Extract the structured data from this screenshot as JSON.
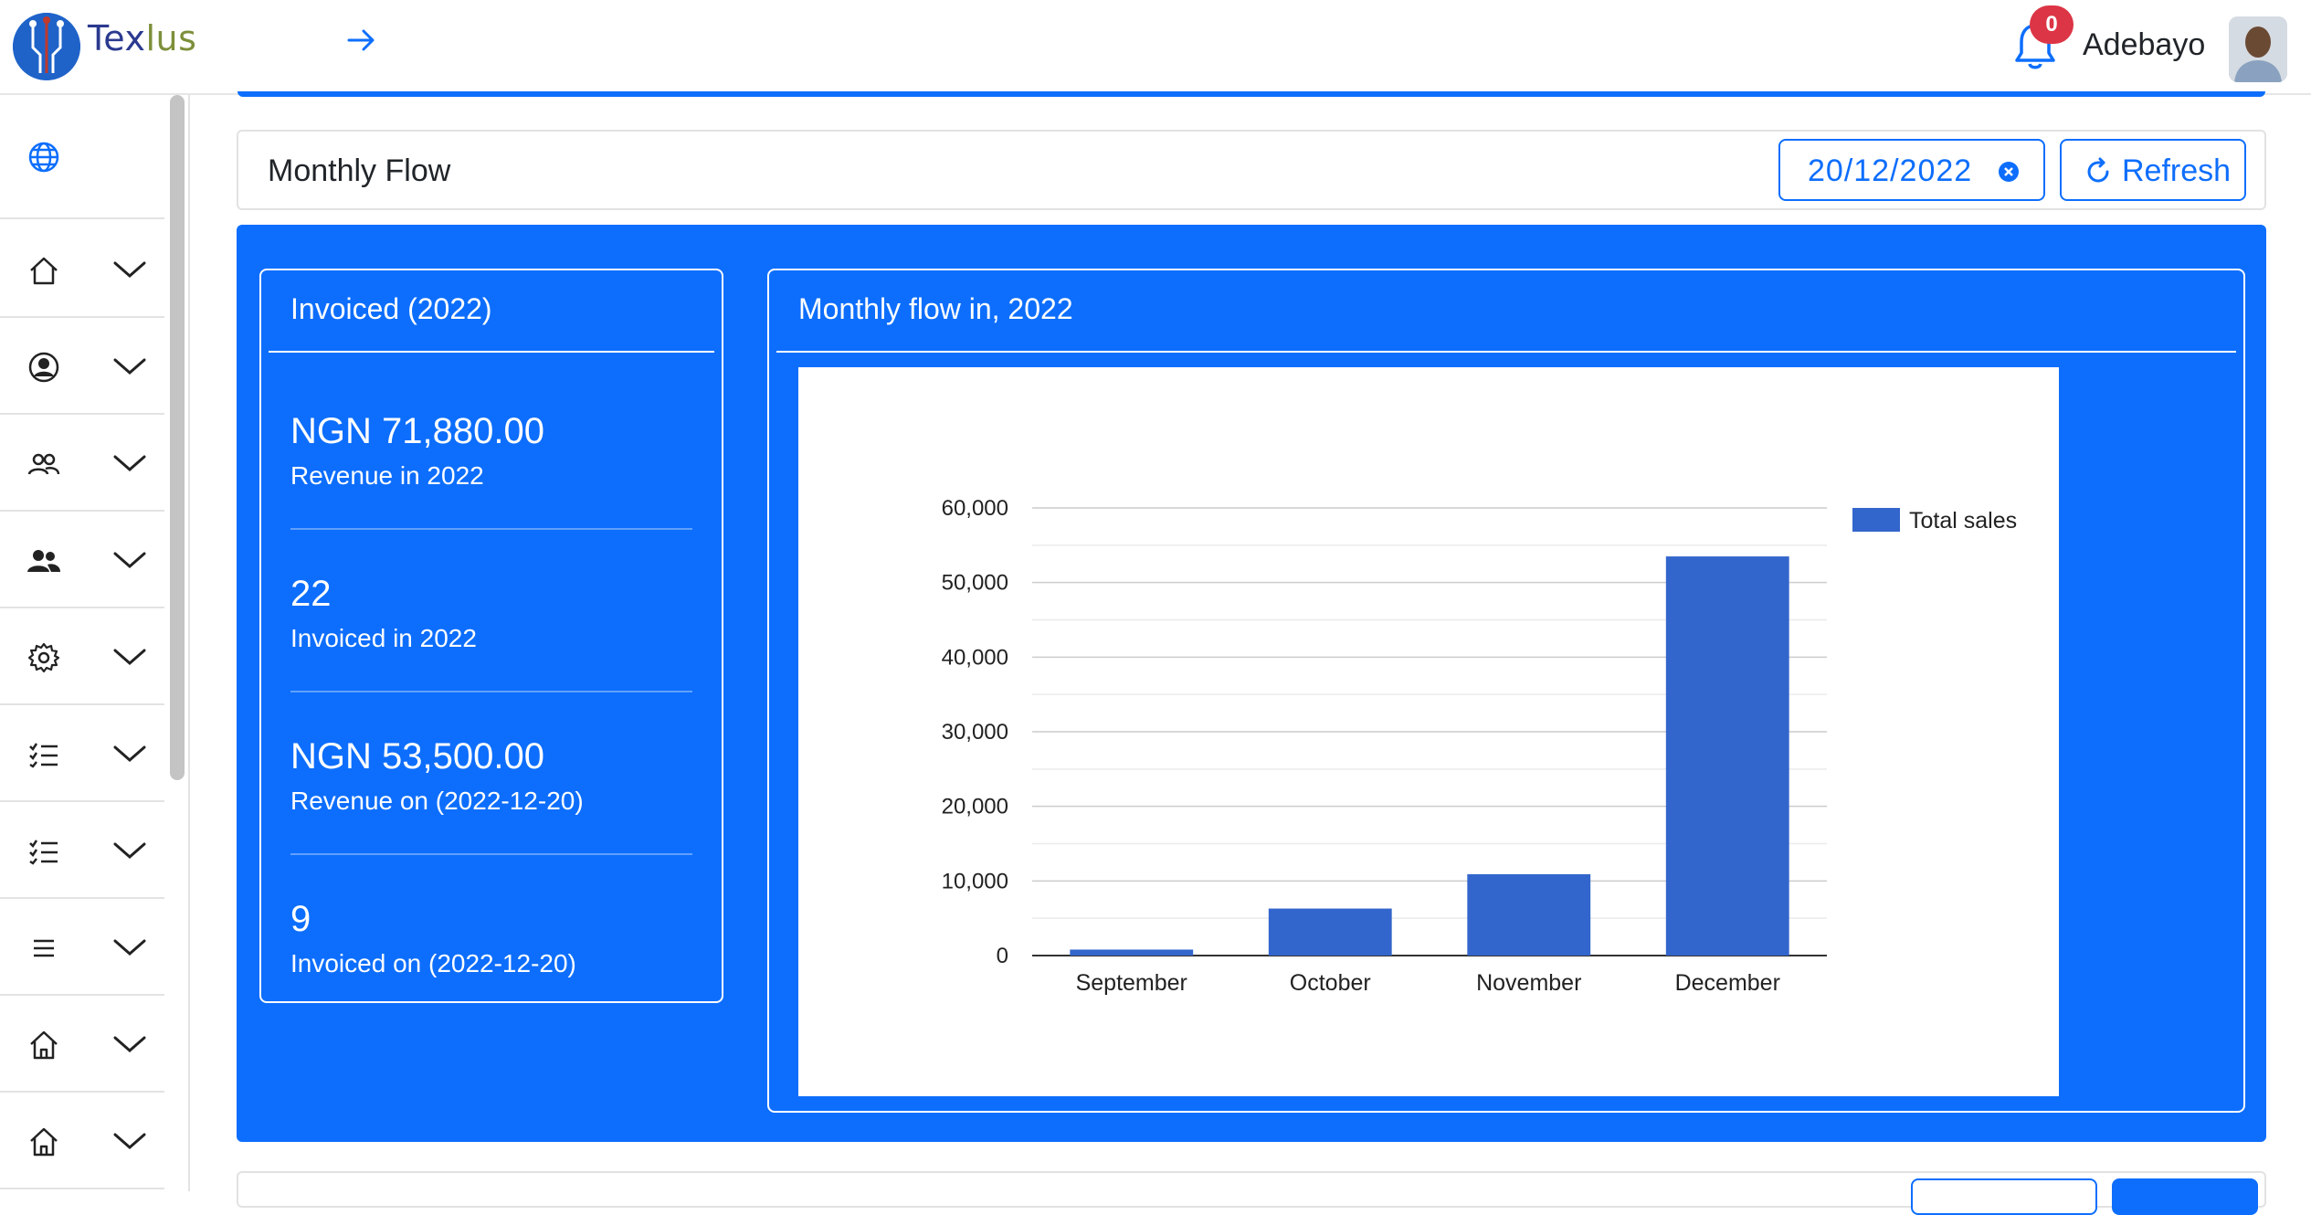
{
  "header": {
    "logo_part1": "Tex",
    "logo_part2": "lus",
    "notification_count": "0",
    "username": "Adebayo"
  },
  "sidebar": {
    "items": [
      {
        "icon": "home-icon"
      },
      {
        "icon": "user-circle-icon"
      },
      {
        "icon": "users-outline-icon"
      },
      {
        "icon": "users-solid-icon"
      },
      {
        "icon": "gear-icon"
      },
      {
        "icon": "checklist-icon"
      },
      {
        "icon": "checklist-icon"
      },
      {
        "icon": "menu-icon"
      },
      {
        "icon": "house-icon"
      },
      {
        "icon": "house-icon"
      }
    ]
  },
  "flow": {
    "title": "Monthly Flow",
    "date": "20/12/2022",
    "refresh_label": "Refresh"
  },
  "invoiced": {
    "title": "Invoiced (2022)",
    "stats": [
      {
        "value": "NGN 71,880.00",
        "label": "Revenue in 2022"
      },
      {
        "value": "22",
        "label": "Invoiced in 2022"
      },
      {
        "value": "NGN 53,500.00",
        "label": "Revenue on (2022-12-20)"
      },
      {
        "value": "9",
        "label": "Invoiced on (2022-12-20)"
      }
    ]
  },
  "chart_card": {
    "title": "Monthly flow in, 2022"
  },
  "colors": {
    "accent": "#0d6efd",
    "bar": "#3366cc",
    "badge": "#dc3545"
  },
  "chart_data": {
    "type": "bar",
    "categories": [
      "September",
      "October",
      "November",
      "December"
    ],
    "series": [
      {
        "name": "Total sales",
        "values": [
          800,
          6300,
          10900,
          53500
        ]
      }
    ],
    "ylim": [
      0,
      60000
    ],
    "yticks": [
      0,
      10000,
      20000,
      30000,
      40000,
      50000,
      60000
    ],
    "ytick_labels": [
      "0",
      "10,000",
      "20,000",
      "30,000",
      "40,000",
      "50,000",
      "60,000"
    ],
    "legend_position": "right",
    "grid": true
  }
}
